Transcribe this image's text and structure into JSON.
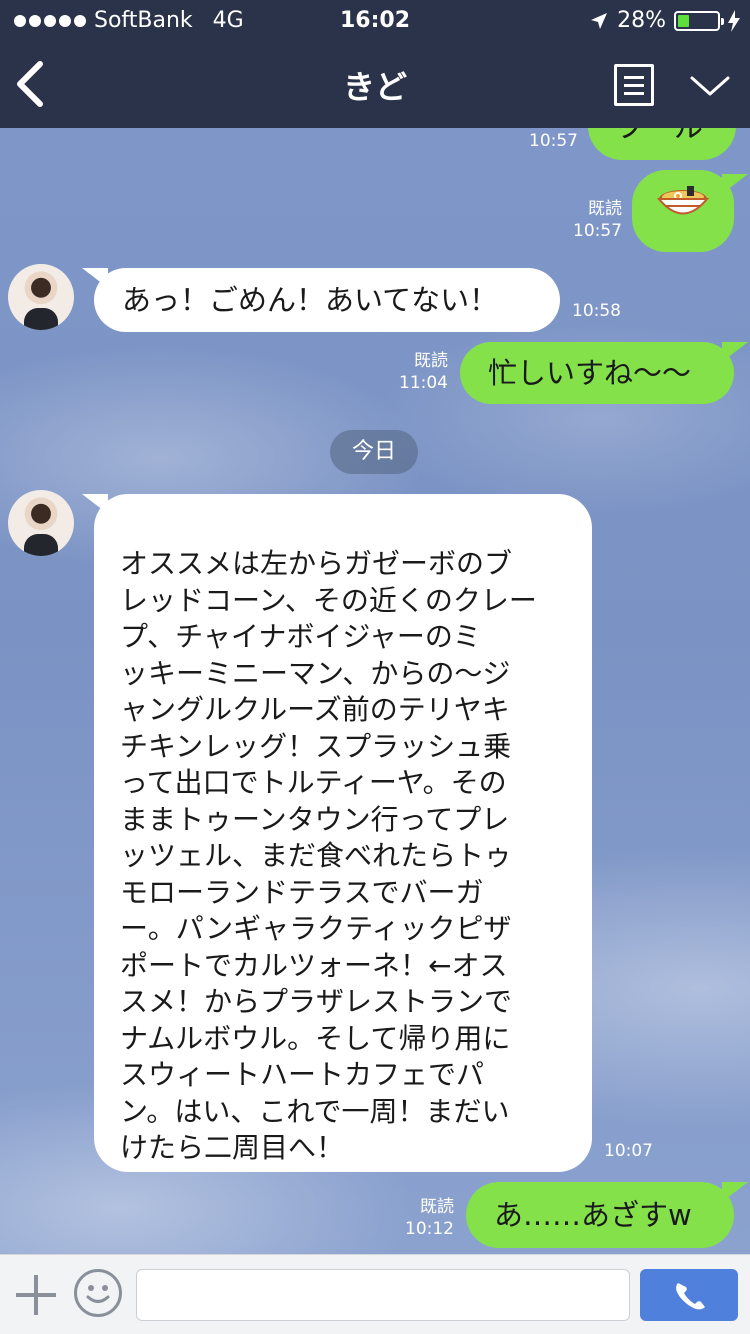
{
  "status_bar": {
    "carrier": "SoftBank",
    "network": "4G",
    "time": "16:02",
    "battery": "28%",
    "battery_level": 0.28
  },
  "header": {
    "title": "きど"
  },
  "messages": [
    {
      "type": "sent",
      "text": "プール",
      "time": "10:57"
    },
    {
      "type": "sent",
      "sticker": "ramen-emoji",
      "read": "既読",
      "time": "10:57"
    },
    {
      "type": "received",
      "text": "あっ！ごめん！あいてない！",
      "time": "10:58"
    },
    {
      "type": "sent",
      "text": "忙しいすね〜〜",
      "read": "既読",
      "time": "11:04"
    },
    {
      "type": "received",
      "text": "オススメは左からガゼーボのブレッドコーン、その近くのクレープ、チャイナボイジャーのミッキーミニーマン、からの〜ジャングルクルーズ前のテリヤキチキンレッグ！スプラッシュ乗って出口でトルティーヤ。そのままトゥーンタウン行ってプレッツェル、まだ食べれたらトゥモローランドテラスでバーガー。パンギャラクティックピザポートでカルツォーネ！←オススメ！からプラザレストランでナムルボウル。そして帰り用にスウィートハートカフェでパン。はい、これで一周！まだいけたら二周目へ！",
      "time": "10:07"
    },
    {
      "type": "sent",
      "text": "あ……あざすw",
      "read": "既読",
      "time": "10:12"
    }
  ],
  "date_separator": "今日",
  "long_message_lines": [
    "オススメは左からガゼーボのブ",
    "レッドコーン、その近くのクレー",
    "プ、チャイナボイジャーのミ",
    "ッキーミニーマン、からの〜ジ",
    "ャングルクルーズ前のテリヤキ",
    "チキンレッグ！スプラッシュ乗",
    "って出口でトルティーヤ。その",
    "ままトゥーンタウン行ってプレ",
    "ッツェル、まだ食べれたらトゥ",
    "モローランドテラスでバーガ",
    "ー。パンギャラクティックピザ",
    "ポートでカルツォーネ！←オス",
    "スメ！からプラザレストランで",
    "ナムルボウル。そして帰り用に",
    "スウィートハートカフェでパ",
    "ン。はい、これで一周！まだい",
    "けたら二周目へ！"
  ],
  "input": {
    "value": "",
    "placeholder": ""
  },
  "colors": {
    "header": "#2a3349",
    "sent_bubble": "#84e14a",
    "received_bubble": "#ffffff",
    "call_button": "#4f80dc"
  },
  "icons": [
    "back-chevron-icon",
    "notes-icon",
    "chevron-down-icon",
    "location-arrow-icon",
    "charging-bolt-icon",
    "plus-icon",
    "emoji-icon",
    "phone-icon",
    "ramen-emoji"
  ]
}
